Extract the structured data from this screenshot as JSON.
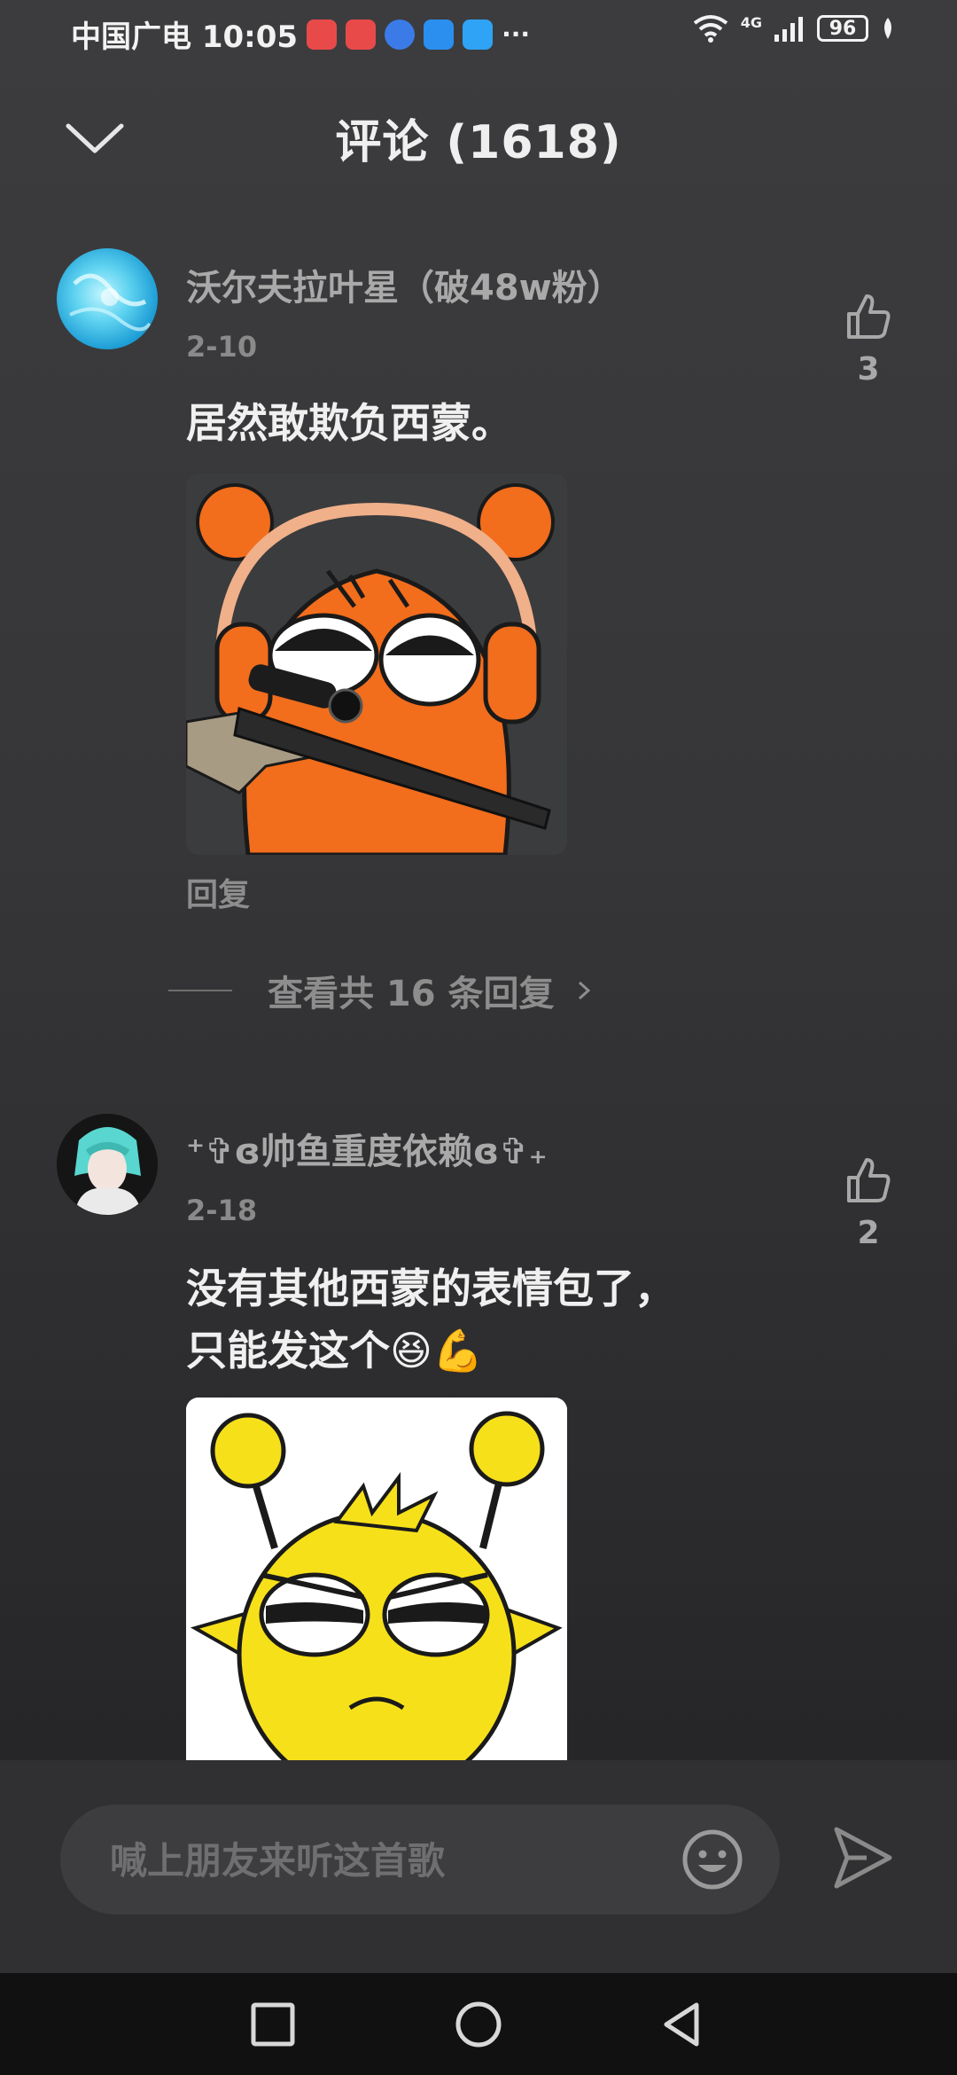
{
  "status_bar": {
    "carrier_time": "中国广电 10:05",
    "network": "4G",
    "battery": "96",
    "app_icon_colors": [
      "#e84a4a",
      "#e84a4a",
      "#3a7be8",
      "#2b8ff0",
      "#2fa3f5"
    ],
    "more": "···"
  },
  "header": {
    "title": "评论 (1618)",
    "collapse_icon": "chevron-down-icon"
  },
  "comments": [
    {
      "username": "沃尔夫拉叶星（破48w粉）",
      "date": "2-10",
      "text_lines": [
        "居然敢欺负西蒙。"
      ],
      "likes": "3",
      "reply_label": "回复",
      "view_replies": "查看共 16 条回复",
      "view_replies_icon": "chevron-right-icon",
      "sticker": "orange-character-with-headphones-and-sniper-rifle"
    },
    {
      "username": "⁺✞ɞ帅鱼重度依赖ɞ✞₊",
      "date": "2-18",
      "text_lines": [
        "没有其他西蒙的表情包了，",
        "只能发这个😆💪"
      ],
      "likes": "2",
      "sticker": "yellow-character-with-antennae"
    }
  ],
  "input": {
    "placeholder": "喊上朋友来听这首歌",
    "emoji_icon": "emoji-icon",
    "send_icon": "send-icon"
  },
  "nav": {
    "recents_icon": "square-icon",
    "home_icon": "circle-icon",
    "back_icon": "triangle-back-icon"
  }
}
